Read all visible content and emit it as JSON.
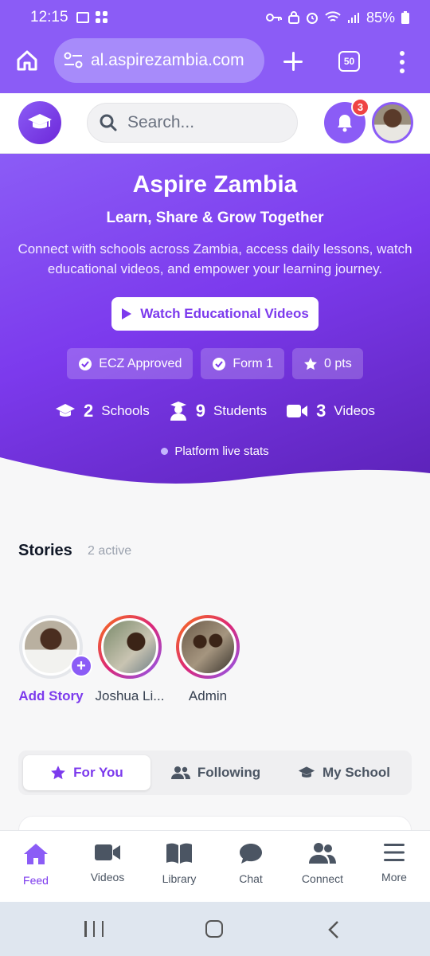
{
  "status_bar": {
    "time": "12:15",
    "battery": "85%"
  },
  "browser": {
    "url": "al.aspirezambia.com",
    "tab_count": "50"
  },
  "header": {
    "search_placeholder": "Search...",
    "notification_count": "3"
  },
  "hero": {
    "title": "Aspire Zambia",
    "tagline": "Learn, Share & Grow Together",
    "description": "Connect with schools across Zambia, access daily lessons, watch educational videos, and empower your learning journey.",
    "cta_label": "Watch Educational Videos",
    "chips": [
      "ECZ Approved",
      "Form 1",
      "0 pts"
    ],
    "stats": [
      {
        "value": "2",
        "label": "Schools",
        "icon": "graduation-cap-icon"
      },
      {
        "value": "9",
        "label": "Students",
        "icon": "student-icon"
      },
      {
        "value": "3",
        "label": "Videos",
        "icon": "video-icon"
      }
    ],
    "live_label": "Platform live stats"
  },
  "stories": {
    "title": "Stories",
    "count_label": "2 active",
    "items": [
      {
        "name": "Add Story",
        "type": "add"
      },
      {
        "name": "Joshua Li..."
      },
      {
        "name": "Admin"
      }
    ]
  },
  "feed_tabs": [
    {
      "label": "For You",
      "icon": "star-icon",
      "active": true
    },
    {
      "label": "Following",
      "icon": "users-icon",
      "active": false
    },
    {
      "label": "My School",
      "icon": "graduation-cap-icon",
      "active": false
    }
  ],
  "bottom_nav": [
    {
      "label": "Feed",
      "icon": "home-icon",
      "active": true
    },
    {
      "label": "Videos",
      "icon": "video-icon"
    },
    {
      "label": "Library",
      "icon": "book-icon"
    },
    {
      "label": "Chat",
      "icon": "chat-icon"
    },
    {
      "label": "Connect",
      "icon": "users-icon"
    },
    {
      "label": "More",
      "icon": "menu-icon"
    }
  ],
  "colors": {
    "brand": "#8b5cf6",
    "brand_dark": "#5b21b6",
    "badge": "#ef4444"
  }
}
